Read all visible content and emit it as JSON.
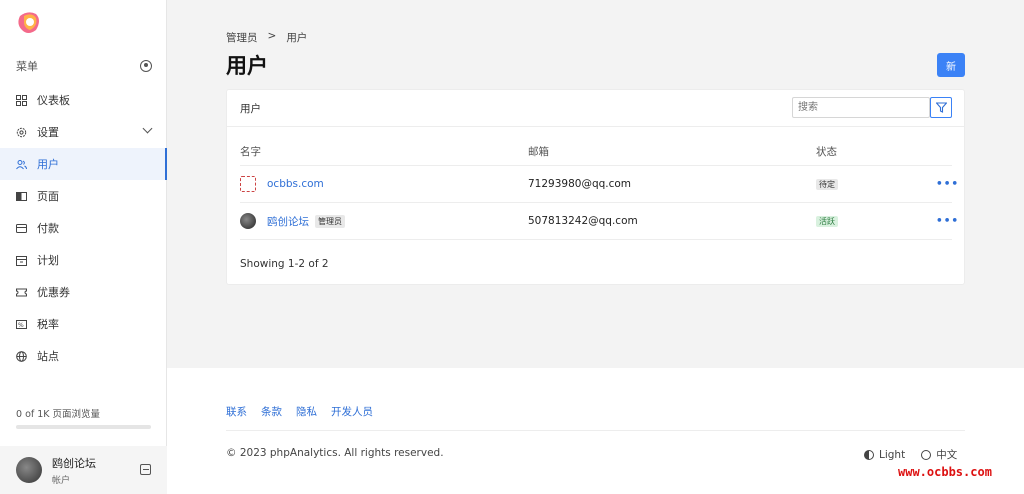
{
  "sidebar": {
    "menu_label": "菜单",
    "items": [
      {
        "label": "仪表板",
        "icon": "grid-icon"
      },
      {
        "label": "设置",
        "icon": "gear-icon"
      },
      {
        "label": "用户",
        "icon": "users-icon"
      },
      {
        "label": "页面",
        "icon": "book-icon"
      },
      {
        "label": "付款",
        "icon": "card-icon"
      },
      {
        "label": "计划",
        "icon": "box-icon"
      },
      {
        "label": "优惠券",
        "icon": "ticket-icon"
      },
      {
        "label": "税率",
        "icon": "receipt-icon"
      },
      {
        "label": "站点",
        "icon": "globe-icon"
      }
    ],
    "usage_text": "0 of 1K 页面浏览量",
    "usage_fraction": 0,
    "account_name": "鸥创论坛",
    "account_sub": "帐户"
  },
  "main": {
    "breadcrumb": [
      "管理员",
      "用户"
    ],
    "breadcrumb_sep": ">",
    "title": "用户",
    "new_button": "新",
    "card_title": "用户",
    "search_placeholder": "搜索",
    "columns": [
      "名字",
      "邮箱",
      "状态"
    ],
    "rows": [
      {
        "name": "ocbbs.com",
        "badge": "",
        "email": "71293980@qq.com",
        "status": "待定"
      },
      {
        "name": "鸥创论坛",
        "badge": "管理员",
        "email": "507813242@qq.com",
        "status": "活跃"
      }
    ],
    "row_action": "•••",
    "showing": "Showing 1-2 of 2"
  },
  "footer": {
    "links": [
      "联系",
      "条款",
      "隐私",
      "开发人员"
    ],
    "copyright": "© 2023 phpAnalytics. All rights reserved.",
    "theme": "Light",
    "language": "中文"
  },
  "watermark": "www.ocbbs.com",
  "colors": {
    "accent": "#2f6fd6",
    "button": "#3b82f6"
  }
}
